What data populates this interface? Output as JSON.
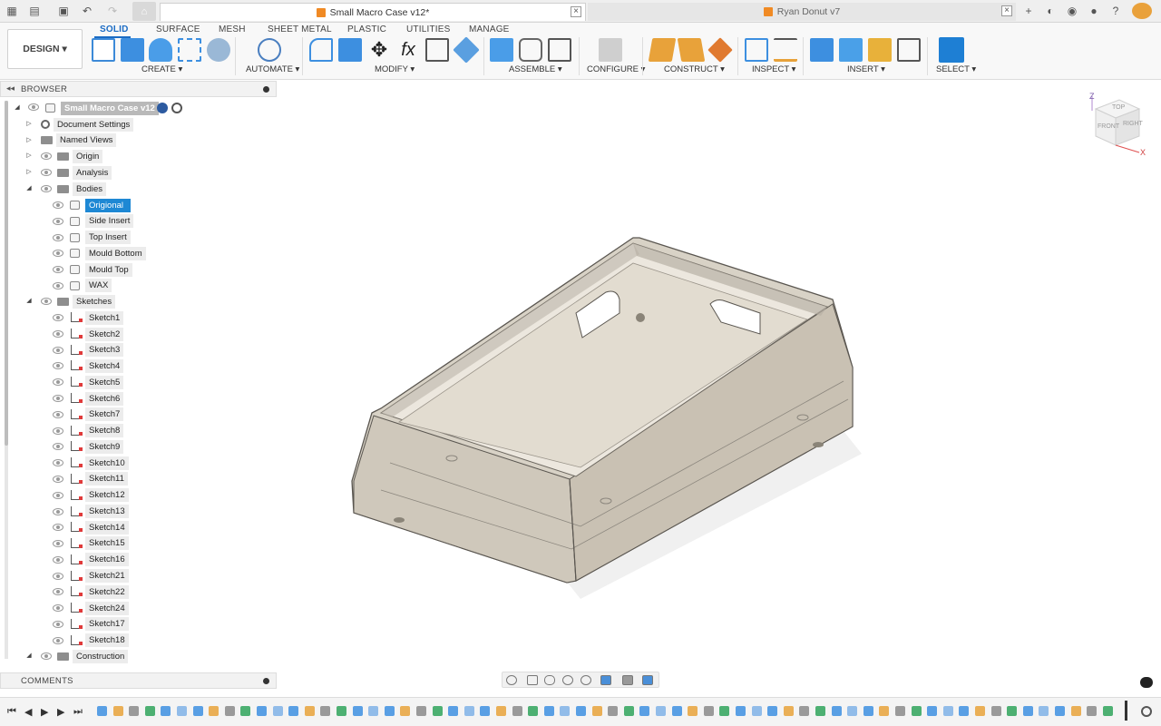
{
  "tabs": [
    {
      "title": "Small Macro Case v12*",
      "active": true
    },
    {
      "title": "Ryan Donut v7",
      "active": false
    }
  ],
  "toolbar": {
    "design_label": "DESIGN ▾",
    "workspace_tabs": [
      "SOLID",
      "SURFACE",
      "MESH",
      "SHEET METAL",
      "PLASTIC",
      "UTILITIES",
      "MANAGE"
    ],
    "groups": [
      "CREATE ▾",
      "AUTOMATE ▾",
      "MODIFY ▾",
      "ASSEMBLE ▾",
      "CONFIGURE ▾",
      "CONSTRUCT ▾",
      "INSPECT ▾",
      "INSERT ▾",
      "SELECT ▾"
    ],
    "accent": "#1a6bc4"
  },
  "browser": {
    "title": "BROWSER",
    "root": "Small Macro Case v12",
    "items": [
      {
        "label": "Document Settings"
      },
      {
        "label": "Named Views"
      },
      {
        "label": "Origin"
      },
      {
        "label": "Analysis"
      },
      {
        "label": "Bodies"
      },
      {
        "label": "Origional"
      },
      {
        "label": "Side Insert"
      },
      {
        "label": "Top Insert"
      },
      {
        "label": "Mould Bottom"
      },
      {
        "label": "Mould Top"
      },
      {
        "label": "WAX"
      },
      {
        "label": "Sketches"
      },
      {
        "label": "Sketch1"
      },
      {
        "label": "Sketch2"
      },
      {
        "label": "Sketch3"
      },
      {
        "label": "Sketch4"
      },
      {
        "label": "Sketch5"
      },
      {
        "label": "Sketch6"
      },
      {
        "label": "Sketch7"
      },
      {
        "label": "Sketch8"
      },
      {
        "label": "Sketch9"
      },
      {
        "label": "Sketch10"
      },
      {
        "label": "Sketch11"
      },
      {
        "label": "Sketch12"
      },
      {
        "label": "Sketch13"
      },
      {
        "label": "Sketch14"
      },
      {
        "label": "Sketch15"
      },
      {
        "label": "Sketch16"
      },
      {
        "label": "Sketch21"
      },
      {
        "label": "Sketch22"
      },
      {
        "label": "Sketch24"
      },
      {
        "label": "Sketch17"
      },
      {
        "label": "Sketch18"
      },
      {
        "label": "Construction"
      }
    ]
  },
  "comments": {
    "title": "COMMENTS"
  },
  "viewcube": {
    "z": "Z",
    "x": "X",
    "front": "FRONT",
    "right": "RIGHT",
    "top": "TOP"
  },
  "colors": {
    "selection": "#1e88d4",
    "model_fill": "#d9d3c8",
    "model_edge": "#5a5650"
  }
}
